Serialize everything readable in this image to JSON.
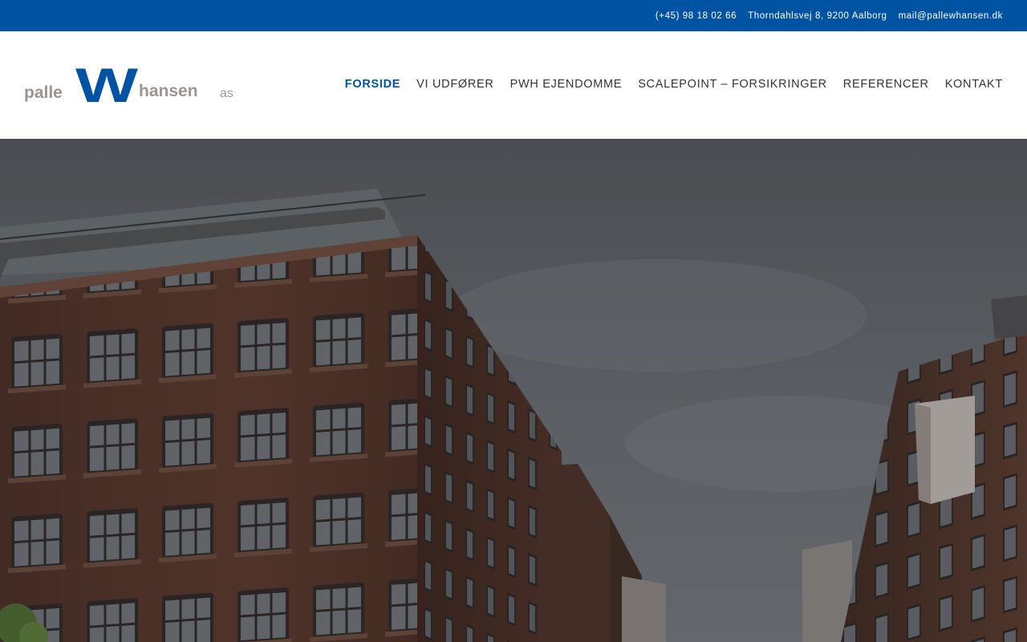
{
  "topbar": {
    "phone": "(+45) 98 18 02 66",
    "address": "Thorndahlsvej 8, 9200 Aalborg",
    "email": "mail@pallewhansen.dk"
  },
  "logo": {
    "word1": "palle",
    "letter": "W",
    "word2": "hansen",
    "suffix": "as"
  },
  "nav": {
    "items": [
      {
        "label": "FORSIDE",
        "active": true
      },
      {
        "label": "VI UDFØRER"
      },
      {
        "label": "PWH EJENDOMME"
      },
      {
        "label": "SCALEPOINT – FORSIKRINGER"
      },
      {
        "label": "REFERENCER"
      },
      {
        "label": "KONTAKT"
      }
    ]
  },
  "colors": {
    "brand_blue": "#0052a2",
    "logo_gray": "#9a9591",
    "nav_text": "#333333"
  },
  "hero": {
    "image": "low-angle-photo-of-red-brick-warehouse-buildings-against-overcast-sky"
  }
}
